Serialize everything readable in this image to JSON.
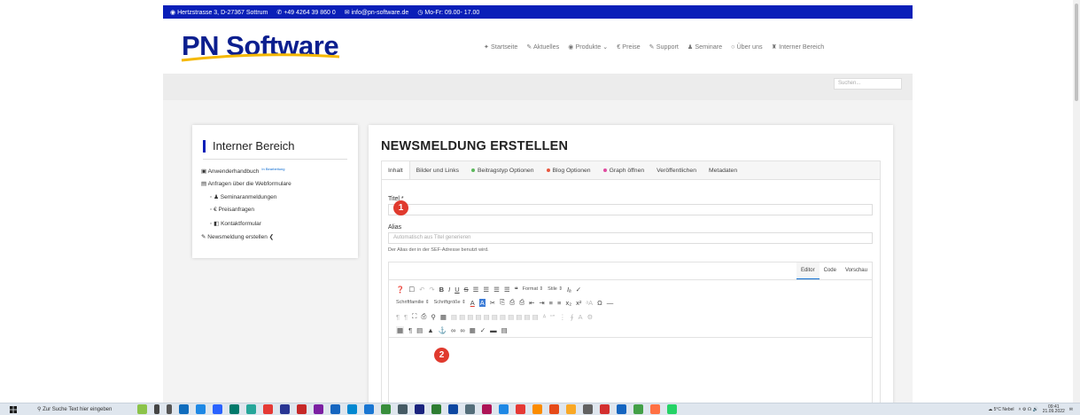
{
  "topbar": {
    "address": "Hertzstrasse 3, D-27367 Sottrum",
    "phone": "+49 4264 39 860 0",
    "email": "info@pn-software.de",
    "hours": "Mo-Fr: 09.00- 17.00"
  },
  "header": {
    "logo": "PN Software",
    "nav": [
      "Startseite",
      "Aktuelles",
      "Produkte",
      "Preise",
      "Support",
      "Seminare",
      "Über uns",
      "Interner Bereich"
    ]
  },
  "search": {
    "placeholder": "Suchen..."
  },
  "sidebar": {
    "title": "Interner Bereich",
    "items": [
      {
        "label": "Anwenderhandbuch",
        "note": "In Bearbeitung"
      },
      {
        "label": "Anfragen über die Webformulare"
      },
      {
        "label": "Seminaranmeldungen"
      },
      {
        "label": "Preisanfragen"
      },
      {
        "label": "Kontaktformular"
      },
      {
        "label": "Newsmeldung erstellen"
      }
    ]
  },
  "main": {
    "title": "NEWSMELDUNG ERSTELLEN",
    "tabs": [
      {
        "label": "Inhalt"
      },
      {
        "label": "Bilder und Links"
      },
      {
        "label": "Beitragstyp Optionen",
        "color": "#5cb85c"
      },
      {
        "label": "Blog Optionen",
        "color": "#e8573f"
      },
      {
        "label": "Graph öffnen",
        "color": "#e04ba0"
      },
      {
        "label": "Veröffentlichen"
      },
      {
        "label": "Metadaten"
      }
    ],
    "title_label": "Titel *",
    "alias_label": "Alias",
    "alias_placeholder": "Automatisch aus Titel generieren",
    "alias_help": "Der Alias der in der SEF-Adresse benutzt wird.",
    "editor_tabs": [
      "Editor",
      "Code",
      "Vorschau"
    ],
    "toolbar": {
      "format": "Format",
      "stile": "Stile",
      "schriftfamilie": "Schriftfamilie",
      "schriftgroesse": "Schriftgröße"
    }
  },
  "badges": [
    "1",
    "2"
  ],
  "taskbar": {
    "search_placeholder": "Zur Suche Text hier eingeben",
    "weather": "5°C Nebel",
    "time": "09:41",
    "date": "21.09.2022"
  }
}
